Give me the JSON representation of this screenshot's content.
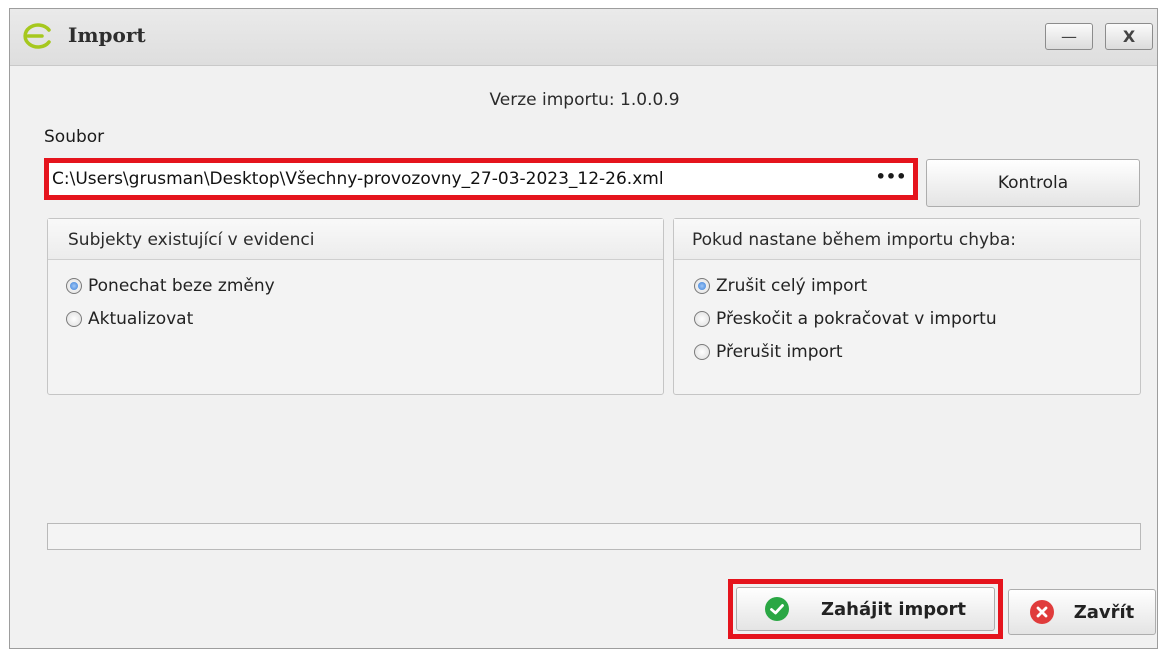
{
  "window": {
    "title": "Import",
    "minimize_glyph": "—",
    "close_glyph": "X"
  },
  "version_text": "Verze importu: 1.0.0.9",
  "file": {
    "label": "Soubor",
    "value": "C:\\Users\\grusman\\Desktop\\Všechny-provozovny_27-03-2023_12-26.xml",
    "browse": "•••"
  },
  "check_button": "Kontrola",
  "group_existing": {
    "title": "Subjekty existující v evidenci",
    "options": [
      {
        "label": "Ponechat beze změny",
        "selected": true
      },
      {
        "label": "Aktualizovat",
        "selected": false
      }
    ]
  },
  "group_error": {
    "title": "Pokud nastane během importu chyba:",
    "options": [
      {
        "label": "Zrušit celý import",
        "selected": true
      },
      {
        "label": "Přeskočit a pokračovat v importu",
        "selected": false
      },
      {
        "label": "Přerušit import",
        "selected": false
      }
    ]
  },
  "progress": 0,
  "buttons": {
    "start": "Zahájit import",
    "close": "Zavřít"
  },
  "colors": {
    "highlight": "#e5141d",
    "accent_green": "#a6c81e",
    "ok_green": "#2aa744",
    "close_red": "#e03c3c"
  },
  "icons": [
    "app-logo-icon",
    "minimize-icon",
    "close-icon",
    "ellipsis-icon",
    "check-circle-icon",
    "x-circle-icon"
  ]
}
